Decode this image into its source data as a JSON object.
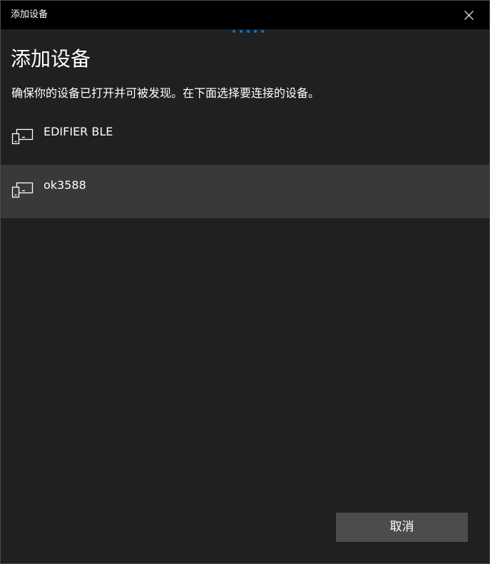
{
  "window": {
    "title": "添加设备",
    "close_icon": "close-icon"
  },
  "progress": {
    "icon": "progress-dots",
    "color": "#0078d7"
  },
  "page": {
    "heading": "添加设备",
    "instruction": "确保你的设备已打开并可被发现。在下面选择要连接的设备。"
  },
  "devices": [
    {
      "name": "EDIFIER BLE",
      "icon": "device-display-icon",
      "selected": false
    },
    {
      "name": "ok3588",
      "icon": "device-display-icon",
      "selected": true
    }
  ],
  "actions": {
    "cancel_label": "取消"
  },
  "colors": {
    "background": "#202020",
    "titlebar": "#000000",
    "selected_row": "#393939",
    "button": "#4c4c4c",
    "accent": "#0078d7"
  }
}
